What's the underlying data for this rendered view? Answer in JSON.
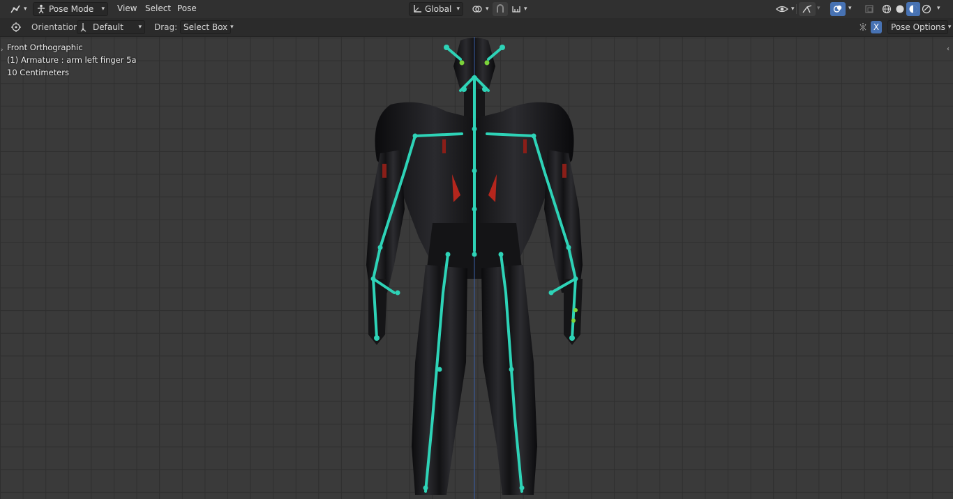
{
  "header": {
    "mode": "Pose Mode",
    "menus": [
      "View",
      "Select",
      "Pose"
    ],
    "transform_orientation": "Global",
    "icons": {
      "editor_type": "armature-editor-icon",
      "mode": "pose-mode-icon",
      "pivot": "transform-pivot-icon",
      "snap": "snap-icon",
      "proportional": "proportional-edit-icon",
      "visibility": "visibility-eye-icon",
      "gizmo": "gizmo-icon",
      "overlay": "overlay-icon",
      "xray": "xray-icon",
      "shading_wire": "wireframe-shading-icon",
      "shading_solid": "solid-shading-icon",
      "shading_material": "material-shading-icon",
      "shading_rendered": "rendered-shading-icon"
    }
  },
  "tool_settings": {
    "orientation_label": "Orientation:",
    "orientation_value": "Default",
    "drag_label": "Drag:",
    "drag_value": "Select Box",
    "axis_button": "X",
    "pose_options": "Pose Options"
  },
  "viewport": {
    "view_name": "Front Orthographic",
    "object_info": "(1) Armature : arm left finger 5a",
    "grid_scale": "10 Centimeters"
  },
  "colors": {
    "bone": "#2ed3b7",
    "bone_selected": "#7cd33a",
    "accent": "#4772b3",
    "axis_line": "#3a5fa8"
  }
}
